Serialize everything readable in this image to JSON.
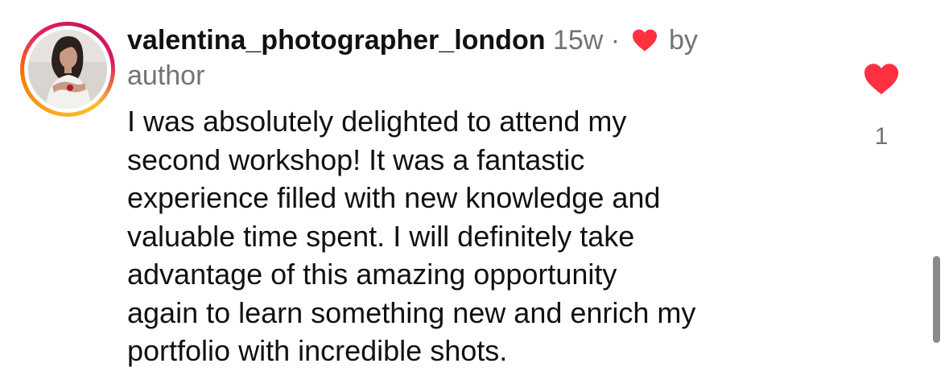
{
  "comment": {
    "username": "valentina_photographer_london",
    "time_ago": "15w",
    "separator": "·",
    "liked_by_label_part1": "by",
    "liked_by_label_part2": "author",
    "text_lines": [
      "I was absolutely delighted to attend my",
      "second workshop! It was a fantastic",
      "experience filled with new knowledge and",
      "valuable time spent. I will definitely take",
      "advantage of this amazing opportunity",
      "again to learn something new and enrich my",
      "portfolio with incredible shots."
    ],
    "like_count": "1",
    "liked": true
  },
  "icons": {
    "author_liked": "heart-icon",
    "like": "heart-icon"
  },
  "colors": {
    "heart": "#ff3040",
    "meta_text": "#737373",
    "avatar_ring_start": "#f9a825",
    "avatar_ring_end": "#d81b60"
  }
}
